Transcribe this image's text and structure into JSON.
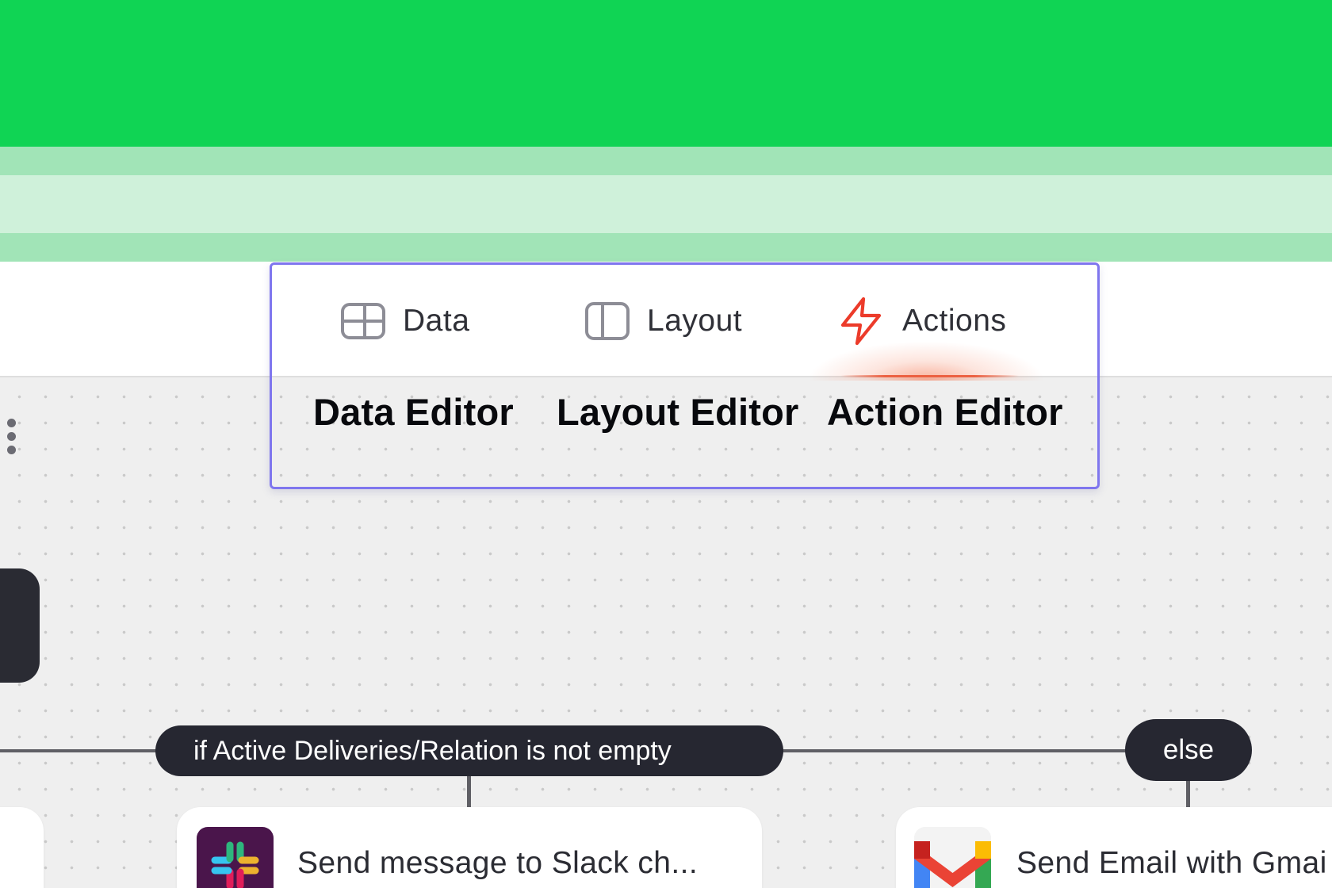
{
  "tabs": {
    "data_label": "Data",
    "layout_label": "Layout",
    "actions_label": "Actions",
    "active": "Actions",
    "active_color": "#ec5c3c"
  },
  "editors": {
    "data": "Data Editor",
    "layout": "Layout Editor",
    "action": "Action Editor"
  },
  "flow": {
    "condition": "if Active Deliveries/Relation is not empty",
    "else_label": "else",
    "steps": [
      {
        "text": "Send message to Slack ch...",
        "icon": "slack-icon"
      },
      {
        "text": "Send Email with Gmai",
        "icon": "gmail-icon"
      }
    ]
  },
  "colors": {
    "brand_green": "#10d454",
    "highlight_border": "#7f76ee",
    "pill_dark": "#262731"
  }
}
